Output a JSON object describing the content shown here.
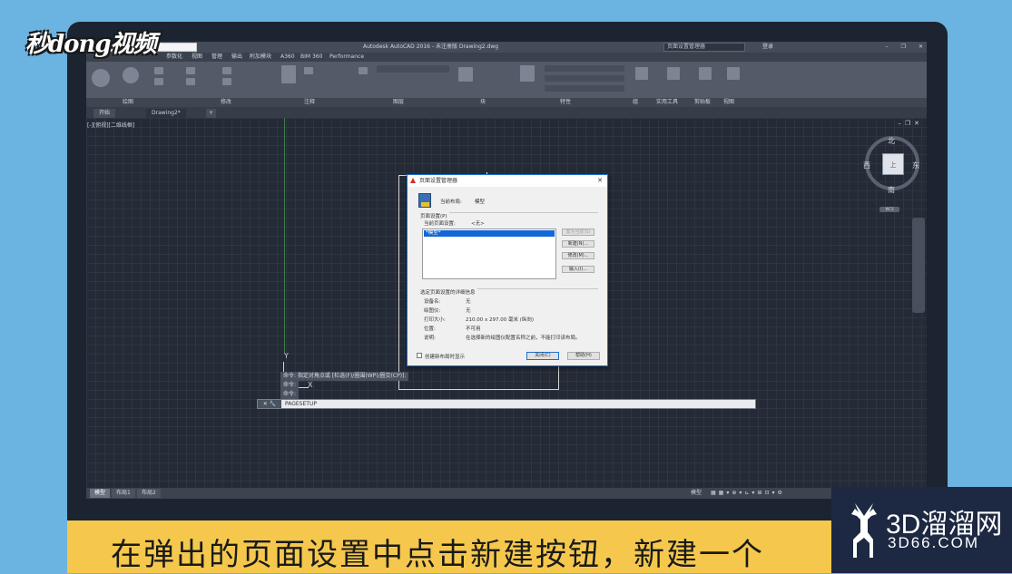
{
  "titlebar": {
    "title": "Autodesk AutoCAD 2016 - 未注册版    Drawing2.dwg",
    "search_placeholder": "页面设置管理器",
    "user": "登录"
  },
  "menubar": {
    "items": [
      "参数化",
      "视图",
      "管理",
      "输出",
      "附加模块",
      "A360",
      "BIM 360",
      "Performance"
    ]
  },
  "panels": [
    "绘图",
    "修改",
    "注释",
    "图层",
    "块",
    "特性",
    "组",
    "实用工具",
    "剪贴板",
    "视图"
  ],
  "file_tabs": {
    "start": "开始",
    "drawing": "Drawing2*"
  },
  "viewport": {
    "label": "[-][俯视][二维线框]",
    "viewcube_face": "上",
    "north": "北",
    "south": "南",
    "east": "东",
    "west": "西",
    "wcs": "WCS",
    "ucs_x": "X",
    "ucs_y": "Y"
  },
  "command": {
    "history": [
      "命令: 指定对角点或 [栏选(F)/圈围(WP)/圈交(CP)]:",
      "命令:",
      "命令:"
    ],
    "current": "PAGESETUP"
  },
  "status": {
    "model": "模型",
    "layout_tabs": [
      "模型",
      "布局1",
      "布局2"
    ]
  },
  "dialog": {
    "title": "页面设置管理器",
    "current_layout_label": "当前布局:",
    "current_layout_value": "模型",
    "page_setups_group": "页面设置(P)",
    "current_page_setup_label": "当前页面设置:",
    "current_page_setup_value": "<无>",
    "list_items": [
      "*模型*"
    ],
    "buttons": {
      "set_current": "置为当前(S)",
      "new": "新建(N)...",
      "modify": "修改(M)...",
      "import": "输入(I)..."
    },
    "details_group": "选定页面设置的详细信息",
    "details": [
      {
        "label": "设备名:",
        "value": "无"
      },
      {
        "label": "绘图仪:",
        "value": "无"
      },
      {
        "label": "打印大小:",
        "value": "210.00 x 297.00 毫米 (纵向)"
      },
      {
        "label": "位置:",
        "value": "不可用"
      },
      {
        "label": "说明:",
        "value": "在选择新的绘图仪配置名称之前，不能打印该布局。"
      }
    ],
    "checkbox_label": "创建新布局时显示",
    "close": "关闭(C)",
    "help": "帮助(H)"
  },
  "watermark": {
    "logo": "秒dong视频"
  },
  "caption": "在弹出的页面设置中点击新建按钮，新建一个",
  "brand": {
    "big": "3D溜溜网",
    "small": "3D66.COM"
  }
}
